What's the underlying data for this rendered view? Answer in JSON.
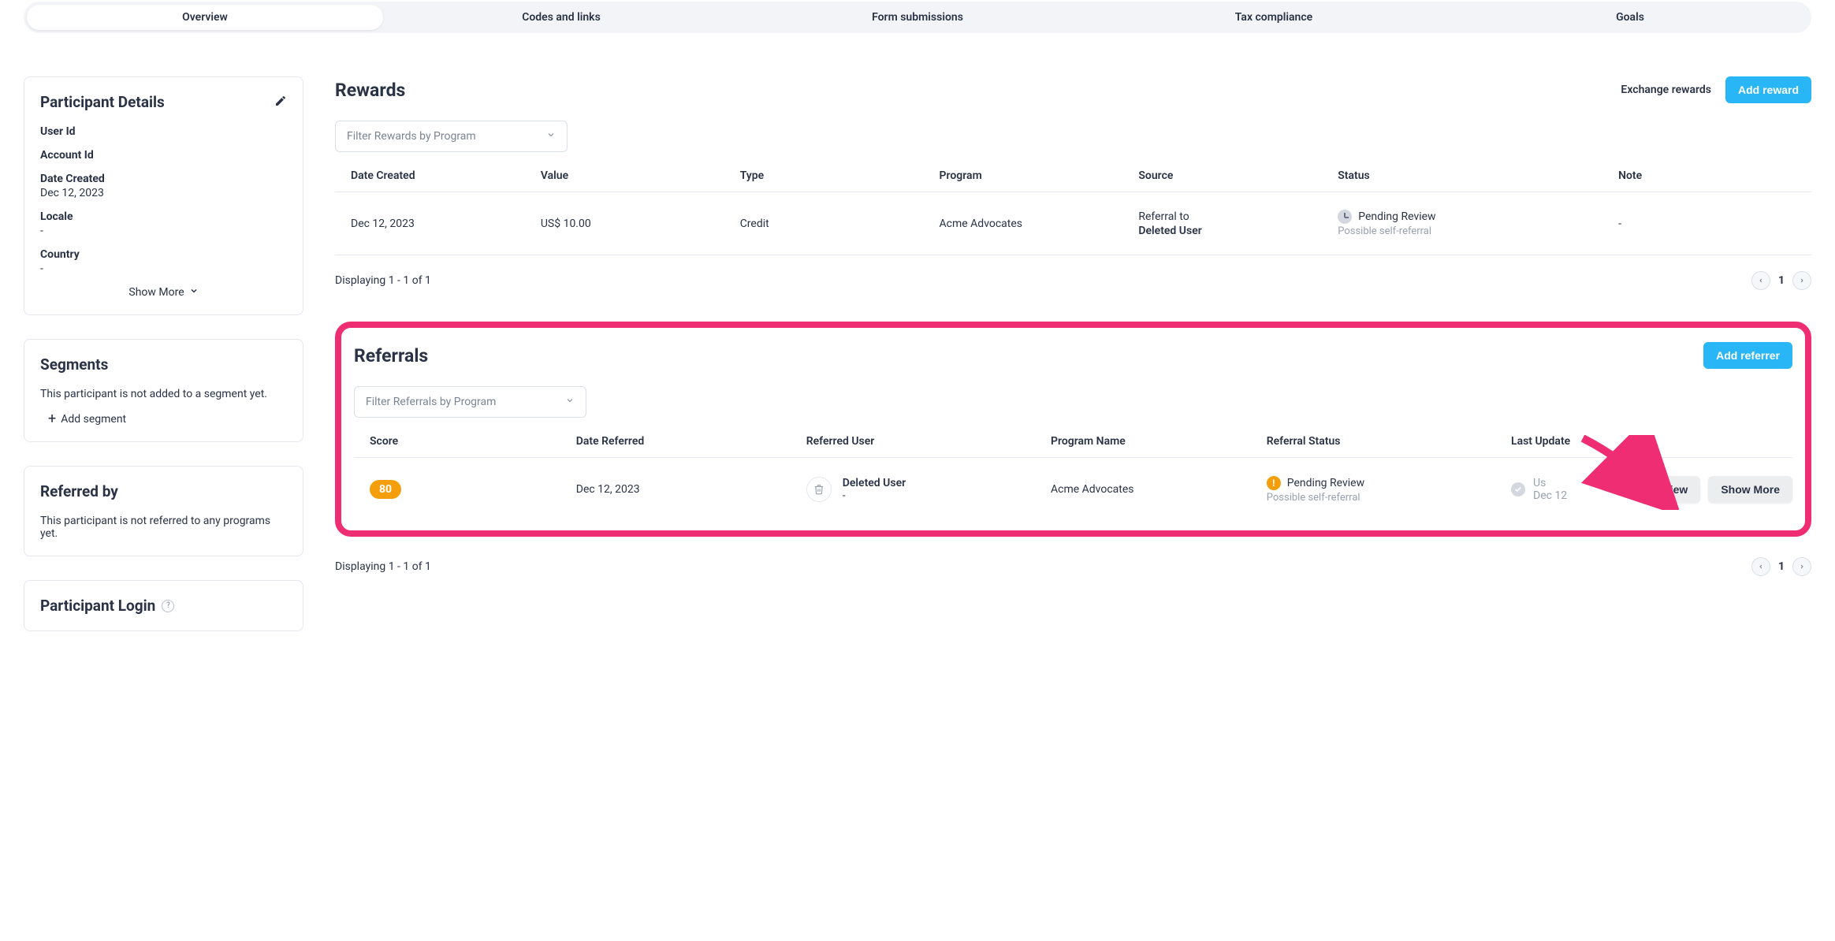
{
  "tabs": {
    "overview": "Overview",
    "codes": "Codes and links",
    "forms": "Form submissions",
    "tax": "Tax compliance",
    "goals": "Goals"
  },
  "sidebar": {
    "participant_details": {
      "title": "Participant Details",
      "user_id_label": "User Id",
      "account_id_label": "Account Id",
      "date_created_label": "Date Created",
      "date_created_value": "Dec 12, 2023",
      "locale_label": "Locale",
      "locale_value": "-",
      "country_label": "Country",
      "country_value": "-",
      "show_more": "Show More"
    },
    "segments": {
      "title": "Segments",
      "empty_text": "This participant is not added to a segment yet.",
      "add_segment": "Add segment"
    },
    "referred_by": {
      "title": "Referred by",
      "empty_text": "This participant is not referred to any programs yet."
    },
    "login": {
      "title": "Participant Login"
    }
  },
  "rewards": {
    "title": "Rewards",
    "exchange_link": "Exchange rewards",
    "add_button": "Add reward",
    "filter_placeholder": "Filter Rewards by Program",
    "columns": {
      "date": "Date Created",
      "value": "Value",
      "type": "Type",
      "program": "Program",
      "source": "Source",
      "status": "Status",
      "note": "Note"
    },
    "rows": [
      {
        "date": "Dec 12, 2023",
        "value": "US$ 10.00",
        "type": "Credit",
        "program": "Acme Advocates",
        "source_label": "Referral to",
        "source_target": "Deleted User",
        "status": "Pending Review",
        "substatus": "Possible self-referral",
        "note": "-"
      }
    ],
    "displaying": "Displaying 1 - 1 of 1",
    "page": "1"
  },
  "referrals": {
    "title": "Referrals",
    "add_button": "Add referrer",
    "filter_placeholder": "Filter Referrals by Program",
    "columns": {
      "score": "Score",
      "date": "Date Referred",
      "user": "Referred User",
      "program": "Program Name",
      "status": "Referral Status",
      "update": "Last Update"
    },
    "rows": [
      {
        "score": "80",
        "date": "Dec 12, 2023",
        "user": "Deleted User",
        "user_sub": "-",
        "program": "Acme Advocates",
        "status": "Pending Review",
        "substatus": "Possible self-referral",
        "update_line1": "Us",
        "update_line2": "Dec 12"
      }
    ],
    "review_btn": "Review",
    "show_more_btn": "Show More",
    "displaying": "Displaying 1 - 1 of 1",
    "page": "1"
  },
  "colors": {
    "accent": "#29b6f6",
    "highlight": "#ef2d72",
    "warning": "#f59e0b"
  }
}
